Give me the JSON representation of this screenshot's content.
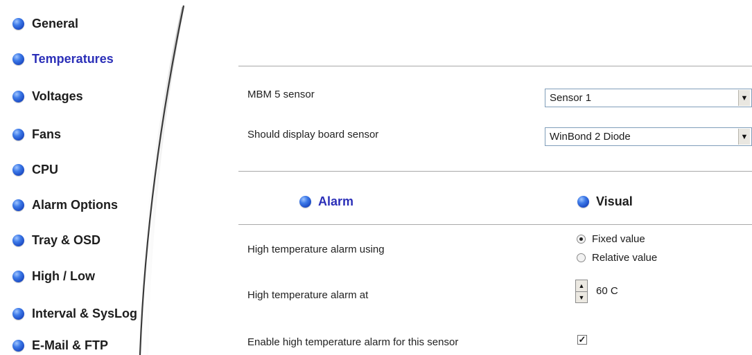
{
  "sidebar": {
    "items": [
      {
        "label": "General",
        "active": false
      },
      {
        "label": "Temperatures",
        "active": true
      },
      {
        "label": "Voltages",
        "active": false
      },
      {
        "label": "Fans",
        "active": false
      },
      {
        "label": "CPU",
        "active": false
      },
      {
        "label": "Alarm Options",
        "active": false
      },
      {
        "label": "Tray & OSD",
        "active": false
      },
      {
        "label": "High / Low",
        "active": false
      },
      {
        "label": "Interval & SysLog",
        "active": false
      },
      {
        "label": "E-Mail & FTP",
        "active": false
      }
    ]
  },
  "sensor": {
    "mbm_label": "MBM 5 sensor",
    "mbm_value": "Sensor 1",
    "board_label": "Should display board sensor",
    "board_value": "WinBond 2 Diode"
  },
  "sections": {
    "alarm": "Alarm",
    "visual": "Visual"
  },
  "alarm": {
    "using_label": "High temperature alarm using",
    "options": [
      {
        "label": "Fixed value",
        "checked": true
      },
      {
        "label": "Relative value",
        "checked": false
      }
    ],
    "at_label": "High temperature alarm at",
    "at_value": "60 C",
    "enable_label": "Enable high temperature alarm for this sensor",
    "enable_checked": true
  },
  "colors": {
    "active_nav": "#2b2fb8",
    "bullet": "#2a5fd6"
  },
  "icons": {
    "bullet": "blue-sphere-icon",
    "dropdown": "dropdown-arrow-icon",
    "check": "checkmark-icon"
  }
}
